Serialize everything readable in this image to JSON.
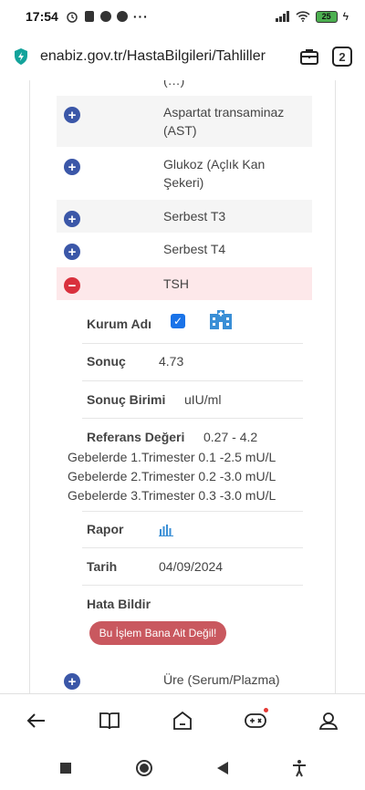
{
  "status_bar": {
    "time": "17:54",
    "battery": "25"
  },
  "browser": {
    "url": "enabiz.gov.tr/HastaBilgileri/Tahliller",
    "tab_count": "2"
  },
  "tests": [
    {
      "name": "(…)"
    },
    {
      "name": "Aspartat transaminaz (AST)"
    },
    {
      "name": "Glukoz (Açlık Kan Şekeri)"
    },
    {
      "name": "Serbest T3"
    },
    {
      "name": "Serbest T4"
    },
    {
      "name": "TSH",
      "expanded": true
    },
    {
      "name": "Üre (Serum/Plazma)"
    }
  ],
  "detail": {
    "institution_label": "Kurum Adı",
    "result_label": "Sonuç",
    "result_value": "4.73",
    "unit_label": "Sonuç Birimi",
    "unit_value": "uIU/ml",
    "reference_label": "Referans Değeri",
    "reference_value": "0.27 - 4.2",
    "trimesters": [
      "Gebelerde 1.Trimester 0.1 -2.5 mU/L",
      "Gebelerde 2.Trimester 0.2 -3.0 mU/L",
      "Gebelerde 3.Trimester 0.3 -3.0 mU/L"
    ],
    "report_label": "Rapor",
    "date_label": "Tarih",
    "date_value": "04/09/2024",
    "error_label": "Hata Bildir",
    "error_button": "Bu İşlem Bana Ait Değil!"
  },
  "colors": {
    "plus": "#3b57a8",
    "minus": "#d9303d",
    "active_row": "#fde8ea",
    "error_button": "#c9585f"
  }
}
